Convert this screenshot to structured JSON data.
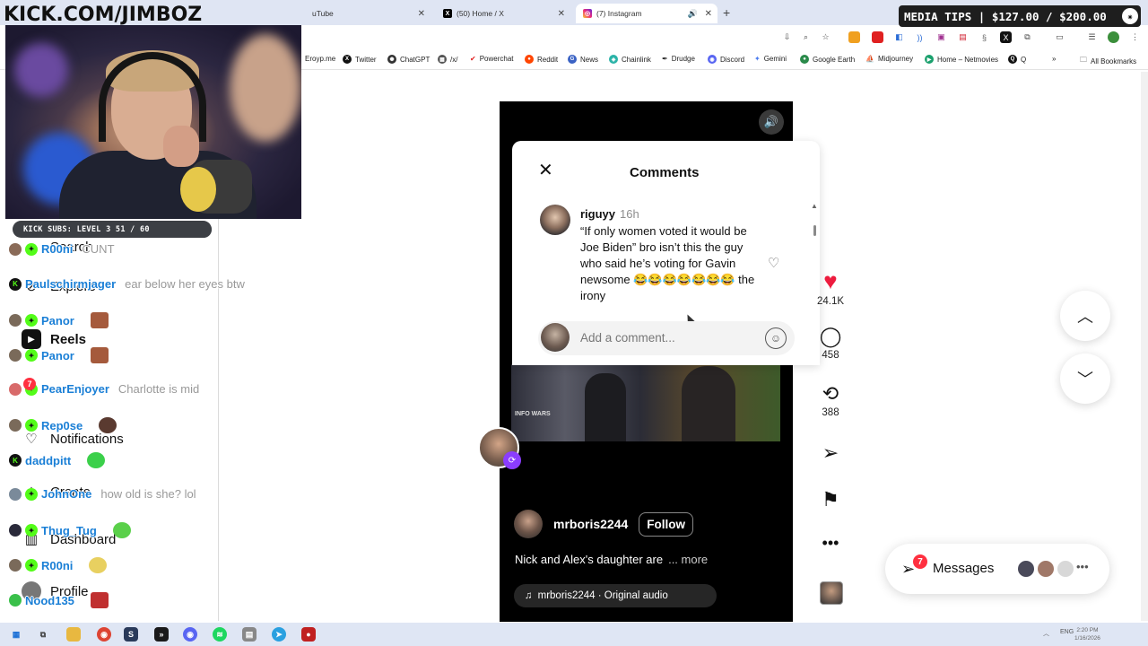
{
  "overlay": {
    "channel_title": "KICK.COM/JIMBOZ",
    "media_tips": "MEDIA TIPS | $127.00 / $200.00",
    "subs_label": "KICK SUBS: LEVEL 3 51 / 60"
  },
  "tabs": [
    {
      "label": "uTube"
    },
    {
      "label": "(50) Home / X"
    },
    {
      "label": "(7) Instagram"
    }
  ],
  "bookmarks": [
    {
      "label": "Eroyp.me"
    },
    {
      "label": "Twitter"
    },
    {
      "label": "ChatGPT"
    },
    {
      "label": "/x/"
    },
    {
      "label": "Powerchat"
    },
    {
      "label": "Reddit"
    },
    {
      "label": "News"
    },
    {
      "label": "Chainlink"
    },
    {
      "label": "Drudge"
    },
    {
      "label": "Discord"
    },
    {
      "label": "Gemini"
    },
    {
      "label": "Google Earth"
    },
    {
      "label": "Midjourney"
    },
    {
      "label": "Home – Netmovies"
    },
    {
      "label": "Q"
    },
    {
      "label": "All Bookmarks"
    }
  ],
  "ig_nav": [
    {
      "label": "Search"
    },
    {
      "label": "Explore"
    },
    {
      "label": "Reels"
    },
    {
      "label": "Notifications"
    },
    {
      "label": "Create"
    },
    {
      "label": "Dashboard"
    },
    {
      "label": "Profile"
    }
  ],
  "chat": [
    {
      "user": "R00ni",
      "text": "CUNT"
    },
    {
      "user": "Paulschirmjager",
      "text": "ear below her eyes btw"
    },
    {
      "user": "Panor",
      "text": ""
    },
    {
      "user": "Panor",
      "text": ""
    },
    {
      "user": "PearEnjoyer",
      "text": "Charlotte is mid"
    },
    {
      "user": "Rep0se",
      "text": ""
    },
    {
      "user": "daddpitt",
      "text": ""
    },
    {
      "user": "JohnOne",
      "text": "how old is she? lol"
    },
    {
      "user": "Thug_Tug",
      "text": ""
    },
    {
      "user": "R00ni",
      "text": ""
    },
    {
      "user": "Nood135",
      "text": ""
    }
  ],
  "comments": {
    "title": "Comments",
    "items": [
      {
        "user": "riguyy",
        "time": "16h",
        "text": "“If only women voted it would be Joe Biden” bro isn’t this the guy who said he’s voting for Gavin newsome 😂😂😂😂😂😂😂 the irony"
      }
    ],
    "input_placeholder": "Add a comment..."
  },
  "reel": {
    "username": "mrboris2244",
    "follow_label": "Follow",
    "caption": "Nick and Alex's daughter are",
    "more_label": "... more",
    "audio": "mrboris2244 · Original audio",
    "video_sign": "INFO WARS"
  },
  "actions": {
    "likes": "24.1K",
    "comments": "458",
    "reposts": "388"
  },
  "messages": {
    "label": "Messages",
    "badge": "7"
  },
  "tab_badge": "7",
  "taskbar": {
    "lang": "ENG",
    "time": "2:20 PM",
    "date": "1/16/2026"
  },
  "colors": {
    "accent_heart": "#ed1c3e",
    "chat_username": "#1a7fd6",
    "kick_green": "#53fc18",
    "badge_red": "#ff3040"
  }
}
